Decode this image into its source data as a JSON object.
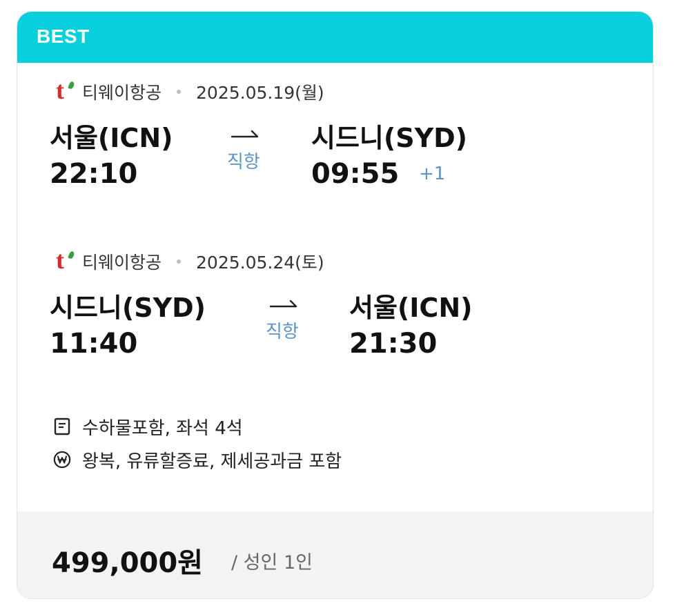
{
  "card": {
    "badge": "BEST",
    "header_color": "#07cfdc"
  },
  "segments": [
    {
      "airline": "티웨이항공",
      "date": "2025.05.19(월)",
      "origin_city": "서울(ICN)",
      "origin_time": "22:10",
      "type": "직항",
      "dest_city": "시드니(SYD)",
      "dest_time": "09:55",
      "day_offset": "+1"
    },
    {
      "airline": "티웨이항공",
      "date": "2025.05.24(토)",
      "origin_city": "시드니(SYD)",
      "origin_time": "11:40",
      "type": "직항",
      "dest_city": "서울(ICN)",
      "dest_time": "21:30",
      "day_offset": ""
    }
  ],
  "info": {
    "baggage_seats": "수하물포함, 좌석 4석",
    "fare_note": "왕복, 유류할증료, 제세공과금 포함"
  },
  "price": {
    "amount": "499,000원",
    "per": "/ 성인 1인"
  },
  "icons": {
    "airline_logo": "tway-logo",
    "info_1": "document-icon",
    "info_2": "won-circle-icon"
  }
}
